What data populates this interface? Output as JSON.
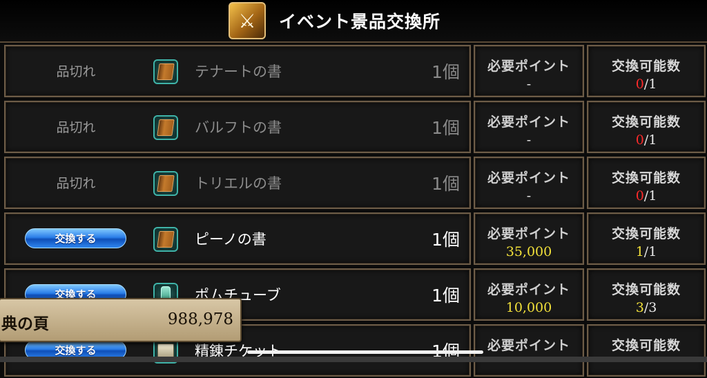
{
  "header": {
    "title": "イベント景品交換所",
    "icon": "event-exchange-icon"
  },
  "rows": [
    {
      "status": "品切れ",
      "exchange_label": "",
      "icon": "book-icon",
      "name": "テナートの書",
      "qty": "1個",
      "req_label": "必要ポイント",
      "req_value": "-",
      "cnt_label": "交換可能数",
      "cnt_used": "0",
      "cnt_sep": "/1"
    },
    {
      "status": "品切れ",
      "exchange_label": "",
      "icon": "book-icon",
      "name": "バルフトの書",
      "qty": "1個",
      "req_label": "必要ポイント",
      "req_value": "-",
      "cnt_label": "交換可能数",
      "cnt_used": "0",
      "cnt_sep": "/1"
    },
    {
      "status": "品切れ",
      "exchange_label": "",
      "icon": "book-icon",
      "name": "トリエルの書",
      "qty": "1個",
      "req_label": "必要ポイント",
      "req_value": "-",
      "cnt_label": "交換可能数",
      "cnt_used": "0",
      "cnt_sep": "/1"
    },
    {
      "status": "",
      "exchange_label": "交換する",
      "icon": "book-icon",
      "name": "ピーノの書",
      "qty": "1個",
      "req_label": "必要ポイント",
      "req_value": "35,000",
      "cnt_label": "交換可能数",
      "cnt_used": "1",
      "cnt_sep": "/1"
    },
    {
      "status": "",
      "exchange_label": "交換する",
      "icon": "bottle-icon",
      "name": "ポムチューブ",
      "qty": "1個",
      "req_label": "必要ポイント",
      "req_value": "10,000",
      "cnt_label": "交換可能数",
      "cnt_used": "3",
      "cnt_sep": "/3"
    },
    {
      "status": "",
      "exchange_label": "交換する",
      "icon": "scroll-icon",
      "name": "精錬チケット",
      "qty": "1個",
      "req_label": "必要ポイント",
      "req_value": "",
      "cnt_label": "交換可能数",
      "cnt_used": "",
      "cnt_sep": ""
    }
  ],
  "points": {
    "label": "典の頁",
    "value": "988,978"
  },
  "colors": {
    "accent_yellow": "#f3e23a",
    "sold_out_red": "#ff2a2a",
    "button_blue": "#2a7ee8",
    "frame_border": "#6d5c47"
  }
}
